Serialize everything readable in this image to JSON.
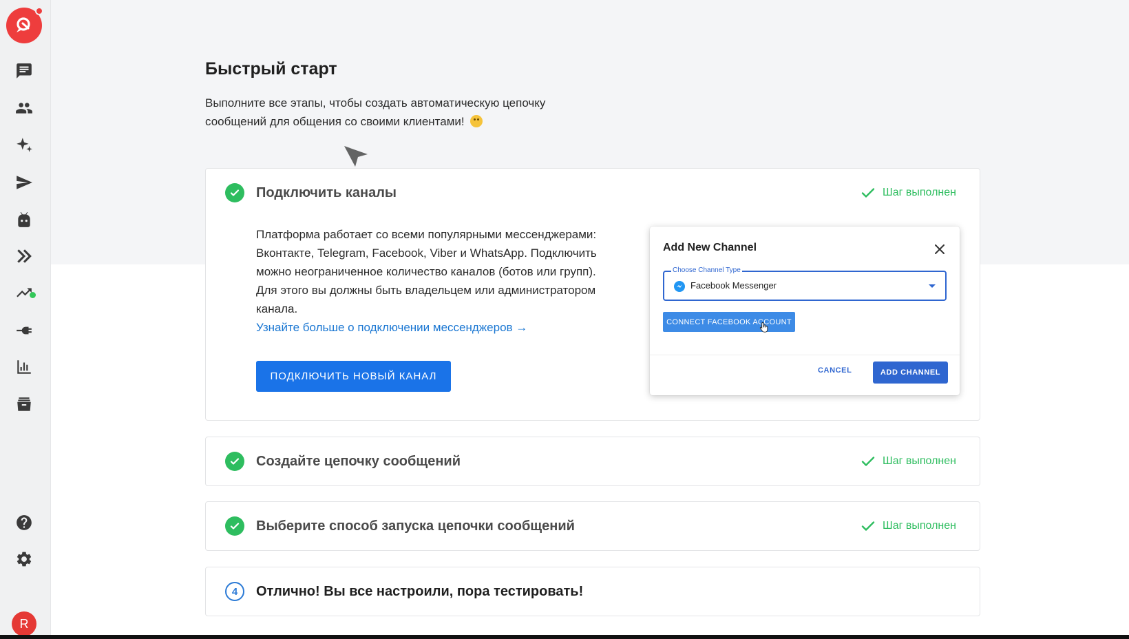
{
  "colors": {
    "brand_red": "#ee3d3d",
    "primary_blue": "#1a73e8",
    "dialog_blue": "#2f66d0",
    "success_green": "#2ebd5f",
    "link_blue": "#1976d2"
  },
  "sidebar": {
    "items": [
      {
        "icon": "chat-icon"
      },
      {
        "icon": "users-icon"
      },
      {
        "icon": "sparkle-icon"
      },
      {
        "icon": "send-icon"
      },
      {
        "icon": "bot-icon"
      },
      {
        "icon": "double-chevron-icon"
      },
      {
        "icon": "trending-icon"
      },
      {
        "icon": "plug-icon"
      },
      {
        "icon": "bar-chart-icon"
      },
      {
        "icon": "archive-icon"
      }
    ],
    "bottom": [
      {
        "icon": "help-icon"
      },
      {
        "icon": "gear-icon"
      }
    ],
    "avatar_letter": "R"
  },
  "page": {
    "title": "Быстрый старт",
    "subtitle_line1": "Выполните все этапы, чтобы создать автоматическую цепочку",
    "subtitle_line2": "сообщений для общения со своими клиентами!"
  },
  "steps": [
    {
      "title": "Подключить каналы",
      "status": "Шаг выполнен",
      "description": "Платформа работает со всеми популярными мессенджерами: Вконтакте, Telegram, Facebook, Viber и WhatsApp. Подключить можно неограниченное количество каналов (ботов или групп). Для этого вы должны быть владельцем или администратором канала.",
      "link": "Узнайте больше о подключении мессенджеров →",
      "button": "ПОДКЛЮЧИТЬ НОВЫЙ КАНАЛ"
    },
    {
      "title": "Создайте цепочку сообщений",
      "status": "Шаг выполнен"
    },
    {
      "title": "Выберите способ запуска цепочки сообщений",
      "status": "Шаг выполнен"
    },
    {
      "number": "4",
      "title": "Отлично! Вы все настроили, пора тестировать!"
    }
  ],
  "dialog": {
    "title": "Add New Channel",
    "select_label": "Choose Channel Type",
    "select_value": "Facebook Messenger",
    "connect_button": "CONNECT FACEBOOK ACCOUNT",
    "cancel": "CANCEL",
    "add": "ADD CHANNEL"
  }
}
